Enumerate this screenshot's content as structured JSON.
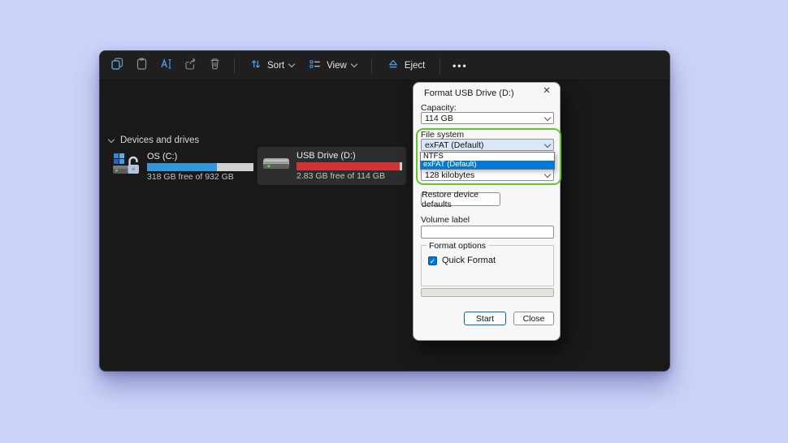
{
  "background_color": "#ccd3f8",
  "explorer": {
    "toolbar": {
      "icons": [
        "copy-icon",
        "paste-icon",
        "rename-icon",
        "share-icon",
        "delete-icon",
        "sort-icon",
        "view-icon",
        "eject-icon",
        "more-icon"
      ],
      "sort": {
        "label": "Sort"
      },
      "view": {
        "label": "View"
      },
      "eject": {
        "label": "Eject"
      }
    },
    "section_header": {
      "label": "Devices and drives"
    },
    "drives": [
      {
        "name": "OS (C:)",
        "capacity_text": "318 GB free of 932 GB",
        "percent_used": 66,
        "bar_color": "#3297dc",
        "selected": false
      },
      {
        "name": "USB Drive (D:)",
        "capacity_text": "2.83 GB free of 114 GB",
        "percent_used": 97.5,
        "bar_color": "#d13438",
        "selected": true
      }
    ]
  },
  "format_dialog": {
    "title": "Format USB Drive (D:)",
    "close_glyph": "×",
    "capacity": {
      "label": "Capacity:",
      "value": "114 GB"
    },
    "file_system": {
      "label": "File system",
      "value": "exFAT (Default)",
      "options": [
        {
          "label": "NTFS",
          "selected": false
        },
        {
          "label": "exFAT (Default)",
          "selected": true
        }
      ]
    },
    "allocation_unit": {
      "value": "128 kilobytes"
    },
    "restore_defaults_label": "Restore device defaults",
    "volume_label": {
      "label": "Volume label",
      "value": ""
    },
    "format_options": {
      "label": "Format options",
      "quick_format_label": "Quick Format",
      "quick_format_checked": true,
      "check_glyph": "✓"
    },
    "progress_percent": 0,
    "buttons": {
      "start": "Start",
      "close": "Close"
    },
    "annotation_color": "#63c629",
    "selection_color": "#0078d7"
  }
}
